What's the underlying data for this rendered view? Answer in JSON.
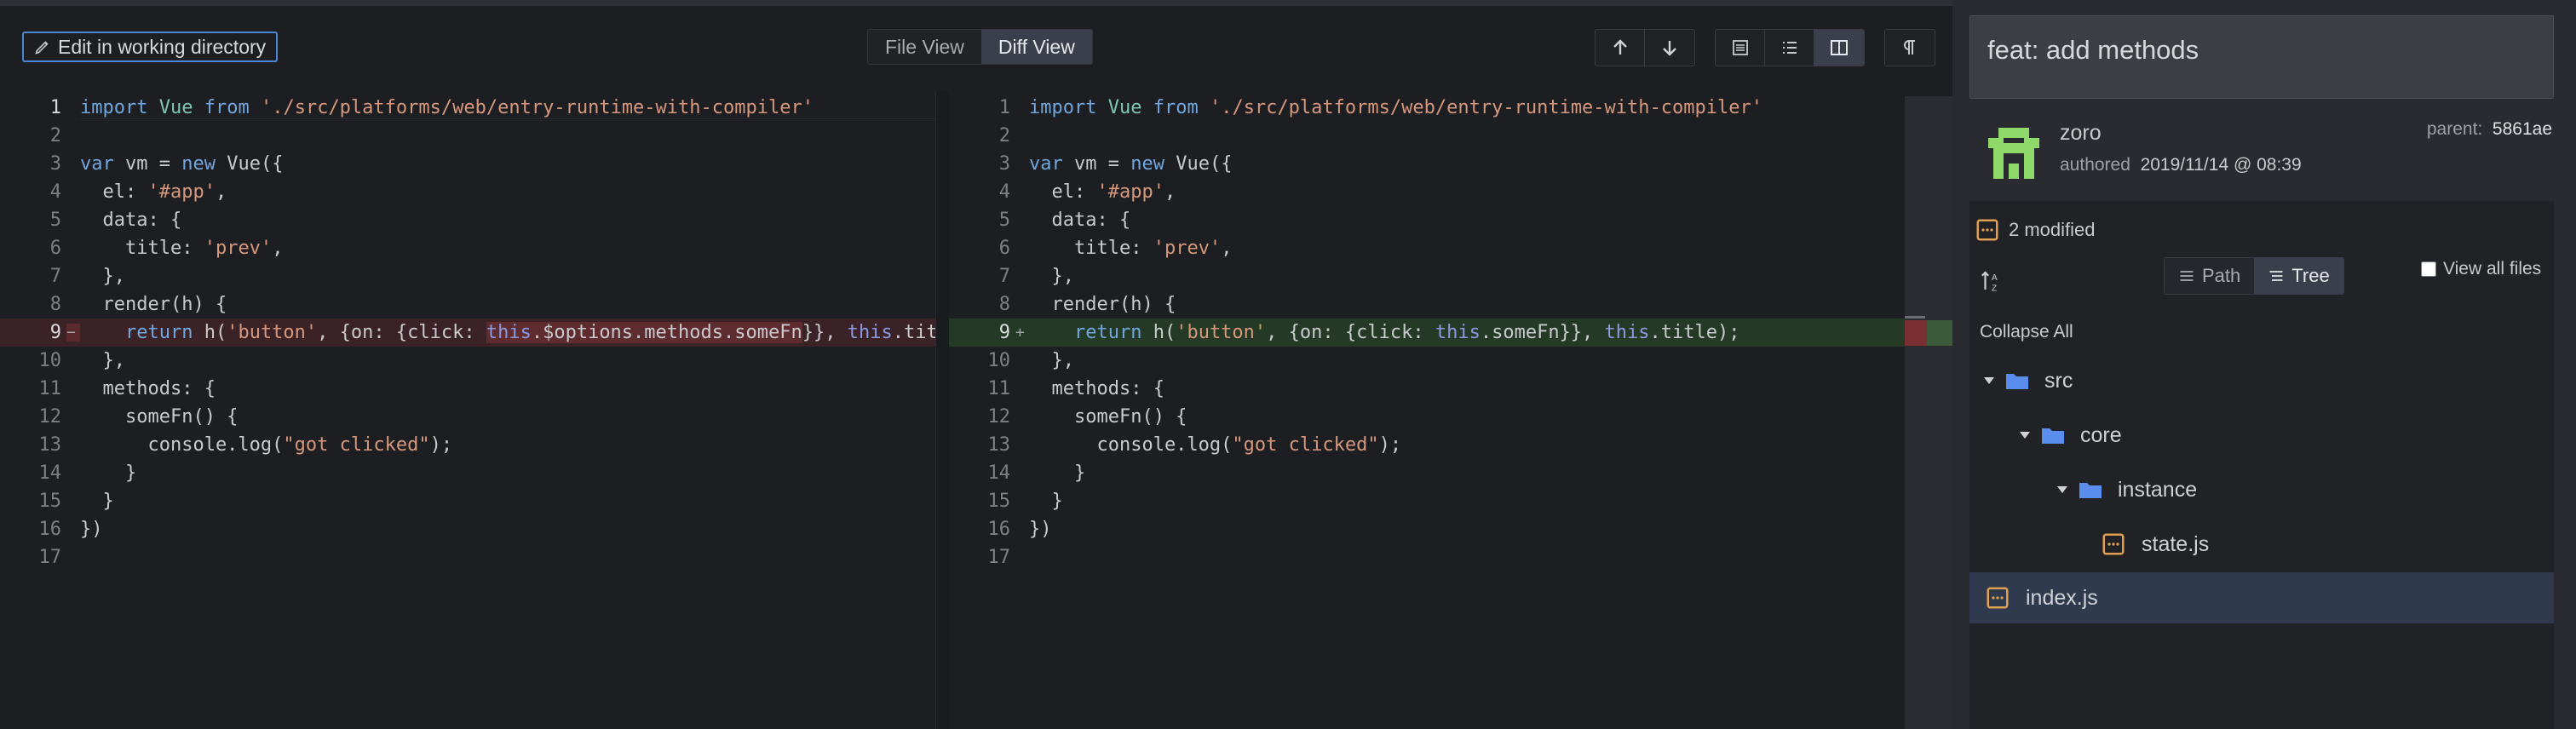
{
  "toolbar": {
    "edit_label": "Edit in working directory",
    "file_view_label": "File View",
    "diff_view_label": "Diff View"
  },
  "icons": {
    "prev_change": "arrow-up-icon",
    "next_change": "arrow-down-icon",
    "view_hunk": "hunk-view-icon",
    "view_inline": "inline-view-icon",
    "view_split": "split-view-icon",
    "whitespace": "pilcrow-icon"
  },
  "colors": {
    "accent": "#4a86d6",
    "deleted_bg": "#3b2226",
    "added_bg": "#243a26",
    "folder": "#5b8def",
    "file": "#e0a050"
  },
  "diff": {
    "left": {
      "lines": [
        {
          "n": "1",
          "marker": ""
        },
        {
          "n": "2",
          "marker": ""
        },
        {
          "n": "3",
          "marker": ""
        },
        {
          "n": "4",
          "marker": ""
        },
        {
          "n": "5",
          "marker": ""
        },
        {
          "n": "6",
          "marker": ""
        },
        {
          "n": "7",
          "marker": ""
        },
        {
          "n": "8",
          "marker": ""
        },
        {
          "n": "9",
          "marker": "−"
        },
        {
          "n": "10",
          "marker": ""
        },
        {
          "n": "11",
          "marker": ""
        },
        {
          "n": "12",
          "marker": ""
        },
        {
          "n": "13",
          "marker": ""
        },
        {
          "n": "14",
          "marker": ""
        },
        {
          "n": "15",
          "marker": ""
        },
        {
          "n": "16",
          "marker": ""
        },
        {
          "n": "17",
          "marker": ""
        }
      ]
    },
    "right": {
      "lines": [
        {
          "n": "1",
          "marker": ""
        },
        {
          "n": "2",
          "marker": ""
        },
        {
          "n": "3",
          "marker": ""
        },
        {
          "n": "4",
          "marker": ""
        },
        {
          "n": "5",
          "marker": ""
        },
        {
          "n": "6",
          "marker": ""
        },
        {
          "n": "7",
          "marker": ""
        },
        {
          "n": "8",
          "marker": ""
        },
        {
          "n": "9",
          "marker": "+"
        },
        {
          "n": "10",
          "marker": ""
        },
        {
          "n": "11",
          "marker": ""
        },
        {
          "n": "12",
          "marker": ""
        },
        {
          "n": "13",
          "marker": ""
        },
        {
          "n": "14",
          "marker": ""
        },
        {
          "n": "15",
          "marker": ""
        },
        {
          "n": "16",
          "marker": ""
        },
        {
          "n": "17",
          "marker": ""
        }
      ]
    },
    "code": {
      "import_kw": "import",
      "vue": "Vue",
      "from_kw": "from",
      "import_path": "'./src/platforms/web/entry-runtime-with-compiler'",
      "var_kw": "var",
      "vm_eq": " vm = ",
      "new_kw": "new",
      "vue_call": " Vue({",
      "el_key": "  el: ",
      "el_val": "'#app'",
      "data_open": "  data: {",
      "title_key": "    title: ",
      "title_val": "'prev'",
      "close_obj": "  },",
      "render_open": "  render(h) {",
      "return_kw": "    return",
      "h_call": " h(",
      "button_str": "'button'",
      "on_click": ", {on: {click: ",
      "this_kw": "this",
      "old_member": ".$options.methods.someFn",
      "new_member": ".someFn",
      "close_call": "}}, ",
      "title_old_tail": ".title",
      "title_new_tail": ".title);",
      "methods_open": "  methods: {",
      "somefn_open": "    someFn() {",
      "console_log": "      console.log(",
      "got_clicked": "\"got clicked\"",
      "close_paren": ");",
      "close_inner": "    }",
      "close_methods": "  }",
      "close_vue": "})"
    }
  },
  "sidebar": {
    "commit_message": "feat: add methods",
    "author": "zoro",
    "authored_label": "authored",
    "authored_date": "2019/11/14 @ 08:39",
    "parent_label": "parent:",
    "parent_hash": "5861ae",
    "modified_count": "2 modified",
    "path_label": "Path",
    "tree_label": "Tree",
    "view_all_label": "View all files",
    "collapse_all_label": "Collapse All",
    "tree": [
      {
        "name": "src",
        "type": "folder"
      },
      {
        "name": "core",
        "type": "folder"
      },
      {
        "name": "instance",
        "type": "folder"
      },
      {
        "name": "state.js",
        "type": "file"
      },
      {
        "name": "index.js",
        "type": "file",
        "selected": true
      }
    ]
  }
}
